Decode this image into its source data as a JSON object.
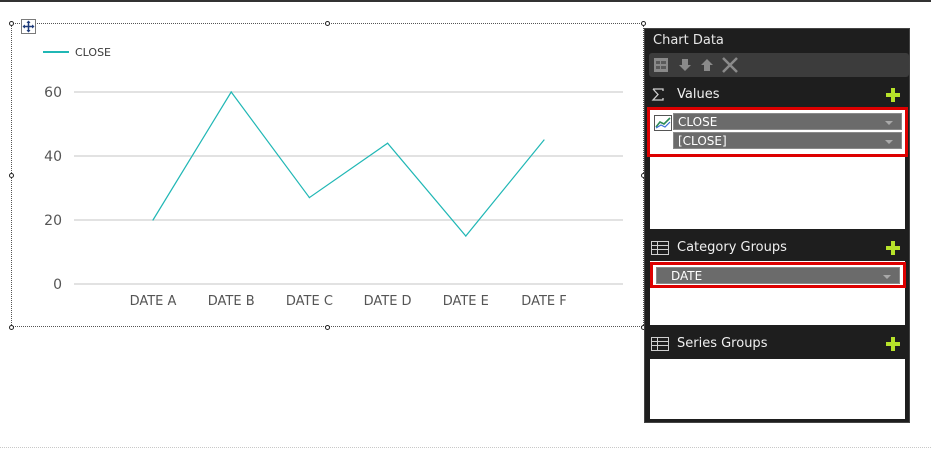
{
  "chart_data": {
    "type": "line",
    "categories": [
      "DATE A",
      "DATE B",
      "DATE C",
      "DATE D",
      "DATE E",
      "DATE F"
    ],
    "series": [
      {
        "name": "CLOSE",
        "values": [
          20,
          60,
          27,
          44,
          15,
          45
        ],
        "color": "#20b7b5"
      }
    ],
    "ylim": [
      0,
      60
    ],
    "yticks": [
      "0",
      "20",
      "40",
      "60"
    ],
    "grid": true,
    "legend": "top-left"
  },
  "panel": {
    "title": "Chart Data",
    "values_section": {
      "label": "Values",
      "fields": [
        {
          "name": "CLOSE",
          "expression": "[CLOSE]"
        }
      ]
    },
    "category_section": {
      "label": "Category Groups",
      "fields": [
        "DATE"
      ]
    },
    "series_section": {
      "label": "Series Groups"
    }
  },
  "colors": {
    "line": "#20b7b5",
    "grid": "#d9d9d9",
    "panel_bg": "#1e1e1e",
    "highlight": "#dd0000",
    "add": "#b7e22a"
  }
}
